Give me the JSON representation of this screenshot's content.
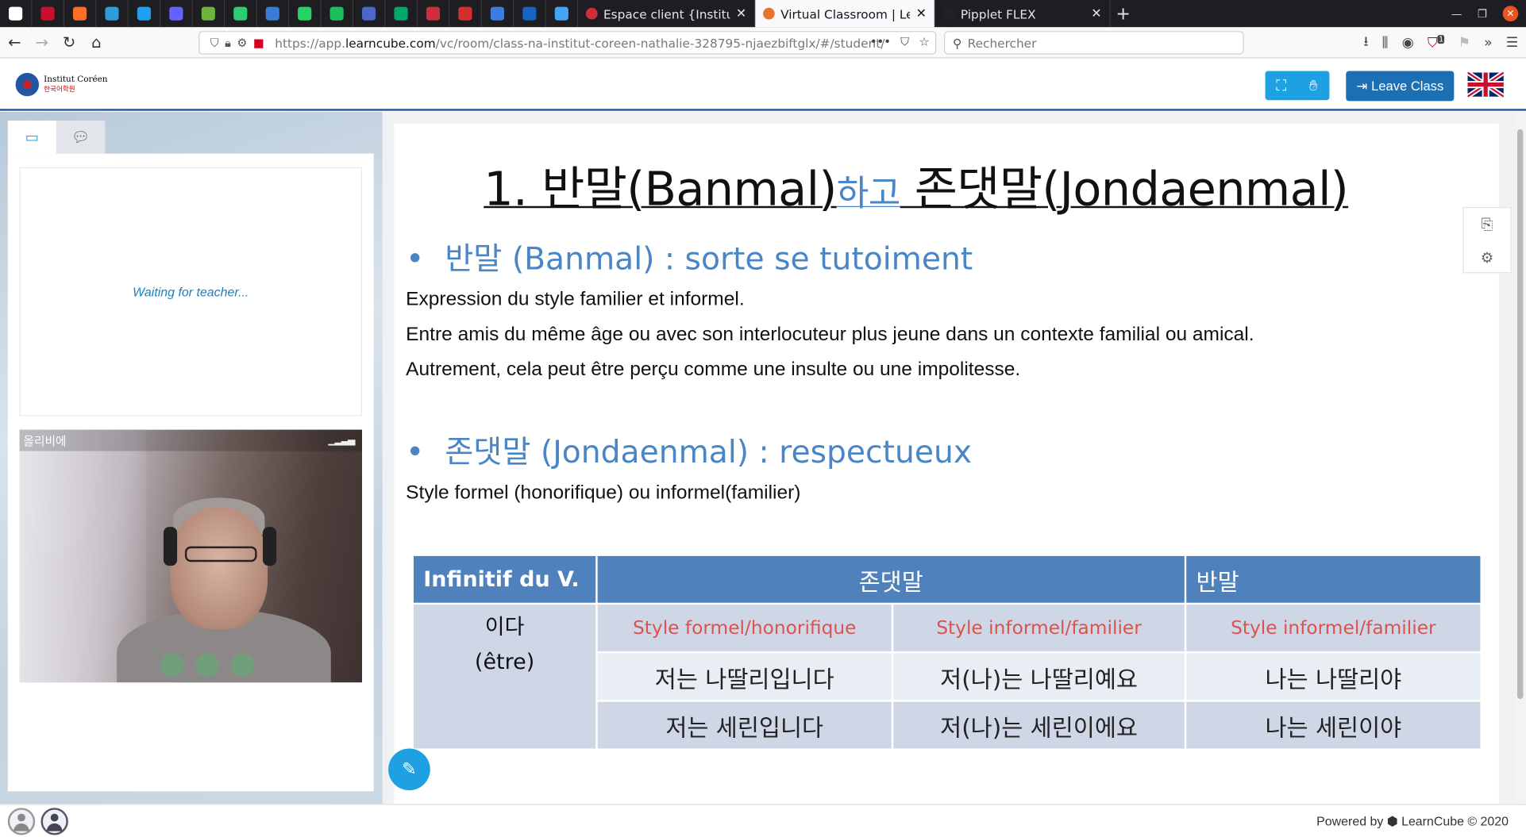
{
  "browser": {
    "pinned_tabs": [
      {
        "icon": "app-icon",
        "color": "#ffffff"
      },
      {
        "icon": "bookmark-red-icon",
        "color": "#c8102e"
      },
      {
        "icon": "gitlab-icon",
        "color": "#fc6d26"
      },
      {
        "icon": "cloud-icon",
        "color": "#2f9bd8"
      },
      {
        "icon": "twitter-icon",
        "color": "#1da1f2"
      },
      {
        "icon": "mastodon-icon",
        "color": "#6364ff"
      },
      {
        "icon": "green-circle-icon",
        "color": "#6fb33c"
      },
      {
        "icon": "green-diamond-icon",
        "color": "#2ecc71"
      },
      {
        "icon": "blue-swirl-icon",
        "color": "#3a7bd5"
      },
      {
        "icon": "whatsapp-icon",
        "color": "#25d366"
      },
      {
        "icon": "green-square-icon",
        "color": "#1ebe5a"
      },
      {
        "icon": "translate-icon",
        "color": "#4a67c9"
      },
      {
        "icon": "green-c-icon",
        "color": "#00a86b"
      },
      {
        "icon": "korean-flag-icon",
        "color": "#cd2e3a"
      },
      {
        "icon": "red-dot-icon",
        "color": "#d32f2f"
      },
      {
        "icon": "calendar-icon",
        "color": "#3d7de0"
      },
      {
        "icon": "blue-globe-icon",
        "color": "#1565c0"
      },
      {
        "icon": "blue-arrow-icon",
        "color": "#42a5f5"
      }
    ],
    "tabs": [
      {
        "title": "Espace client {Institut Co",
        "close": "✕",
        "favicon_color": "#cd2e3a",
        "active": false
      },
      {
        "title": "Virtual Classroom | Learn",
        "close": "✕",
        "favicon_color": "#e8742a",
        "active": true
      },
      {
        "title": "Pipplet FLEX",
        "close": "✕",
        "favicon_color": "#222222",
        "active": false
      }
    ],
    "new_tab": "+",
    "url_host": "https://app.",
    "url_domain": "learncube.com",
    "url_path": "/vc/room/class-na-institut-coreen-nathalie-328795-njaezbiftglx/#/student/",
    "search_placeholder": "Rechercher",
    "ublock_badge": "1"
  },
  "app": {
    "logo_line1": "Institut Coréen",
    "logo_line2": "한국어학원",
    "leave_label": "Leave Class",
    "waiting_text": "Waiting for teacher...",
    "participant_name": "올리비에",
    "footer_text": "Powered by ⬢ LearnCube © 2020"
  },
  "slide": {
    "title_part1": "1. 반말(Banmal)",
    "title_link": "하고",
    "title_part2": " 존댓말(Jondaenmal)",
    "bullet1": "반말 (Banmal) :  sorte se tutoiment",
    "para1": "Expression du style familier et informel.",
    "para2": "Entre amis du même âge ou avec son interlocuteur plus jeune dans un contexte familial ou amical.",
    "para3": "Autrement, cela peut être perçu comme une insulte ou une impolitesse.",
    "bullet2": "존댓말 (Jondaenmal) :  respectueux",
    "para4": "Style formel (honorifique) ou informel(familier)",
    "table": {
      "h1": "Infinitif du V.",
      "h2": "존댓말",
      "h3": "반말",
      "verb": "이다",
      "verb_fr": "(être)",
      "sub1": "Style formel/honorifique",
      "sub2": "Style informel/familier",
      "sub3": "Style informel/familier",
      "r1c1": "저는 나딸리입니다",
      "r1c2": "저(나)는 나딸리예요",
      "r1c3": "나는 나딸리야",
      "r2c1": "저는 세린입니다",
      "r2c2": "저(나)는 세린이에요",
      "r2c3": "나는 세린이야"
    }
  }
}
